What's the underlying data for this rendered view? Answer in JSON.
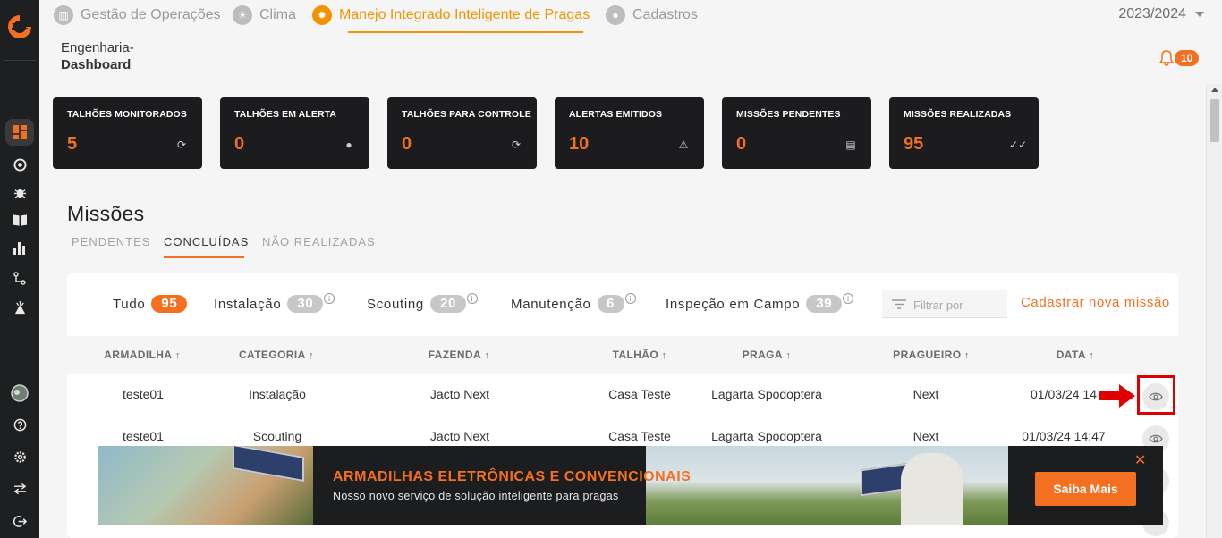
{
  "nav": {
    "items": [
      {
        "label": "Gestão de Operações",
        "icon": "operations-icon"
      },
      {
        "label": "Clima",
        "icon": "climate-icon"
      },
      {
        "label": "Manejo Integrado Inteligente de Pragas",
        "icon": "pest-management-icon"
      },
      {
        "label": "Cadastros",
        "icon": "user-icon"
      }
    ],
    "active_index": 2,
    "season": "2023/2024"
  },
  "breadcrumb": {
    "line1": "Engenharia-",
    "line2": "Dashboard"
  },
  "notifications": {
    "count": "10"
  },
  "cards": [
    {
      "title": "TALHÕES MONITORADOS",
      "value": "5",
      "icon": "refresh-icon"
    },
    {
      "title": "TALHÕES EM ALERTA",
      "value": "0",
      "icon": "dot-icon"
    },
    {
      "title": "TALHÕES PARA CONTROLE",
      "value": "0",
      "icon": "refresh-icon"
    },
    {
      "title": "ALERTAS EMITIDOS",
      "value": "10",
      "icon": "warning-icon"
    },
    {
      "title": "MISSÕES PENDENTES",
      "value": "0",
      "icon": "list-icon"
    },
    {
      "title": "MISSÕES REALIZADAS",
      "value": "95",
      "icon": "double-check-icon"
    }
  ],
  "section": {
    "title": "Missões",
    "tabs": [
      "PENDENTES",
      "CONCLUÍDAS",
      "NÃO REALIZADAS"
    ],
    "active_tab": 1
  },
  "filters": [
    {
      "label": "Tudo",
      "count": "95"
    },
    {
      "label": "Instalação",
      "count": "30"
    },
    {
      "label": "Scouting",
      "count": "20"
    },
    {
      "label": "Manutenção",
      "count": "6"
    },
    {
      "label": "Inspeção em Campo",
      "count": "39"
    }
  ],
  "search": {
    "placeholder": "Filtrar por"
  },
  "new_mission": "Cadastrar nova missão",
  "table": {
    "columns": [
      "ARMADILHA",
      "CATEGORIA",
      "FAZENDA",
      "TALHÃO",
      "PRAGA",
      "PRAGUEIRO",
      "DATA"
    ],
    "rows": [
      [
        "teste01",
        "Instalação",
        "Jacto Next",
        "Casa Teste",
        "Lagarta Spodoptera",
        "Next",
        "01/03/24 14"
      ],
      [
        "teste01",
        "Scouting",
        "Jacto Next",
        "Casa Teste",
        "Lagarta Spodoptera",
        "Next",
        "01/03/24 14:47"
      ]
    ]
  },
  "banner": {
    "title": "ARMADILHAS ELETRÔNICAS E CONVENCIONAIS",
    "subtitle": "Nosso novo serviço de solução inteligente para pragas",
    "button": "Saiba Mais",
    "close": "✕"
  },
  "colors": {
    "accent": "#f37021",
    "nav_active": "#f39200",
    "card_bg": "#1c1c1e",
    "rail_bg": "#1e1f21"
  }
}
